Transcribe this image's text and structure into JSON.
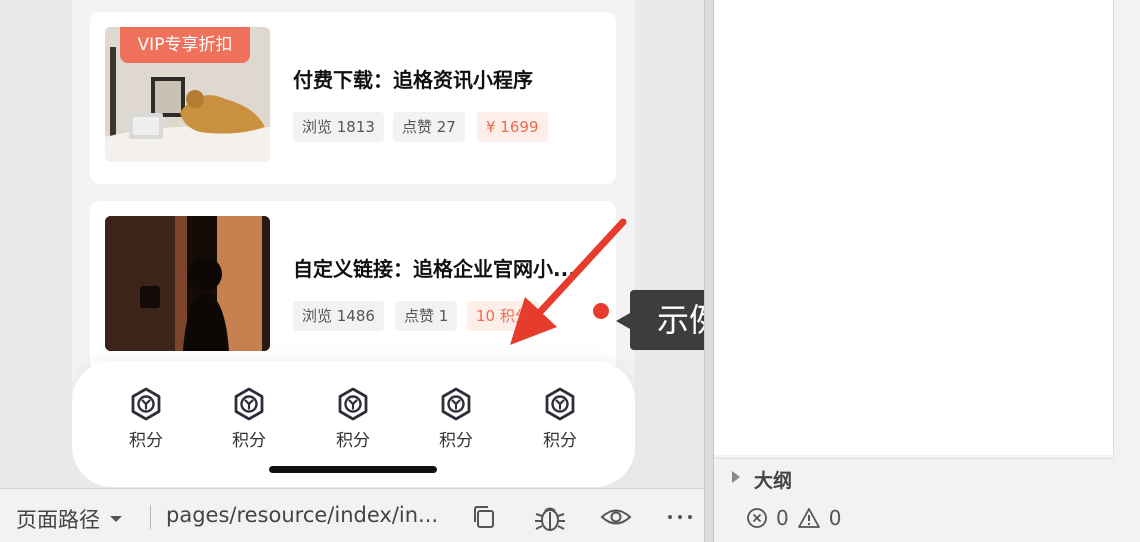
{
  "cards": [
    {
      "badge": "VIP专享折扣",
      "title": "付费下载：追格资讯小程序",
      "views": "浏览 1813",
      "likes": "点赞 27",
      "price": "¥ 1699"
    },
    {
      "title": "自定义链接：追格企业官网小...",
      "views": "浏览 1486",
      "likes": "点赞 1",
      "price": "10 积分"
    }
  ],
  "tabbar": {
    "items": [
      {
        "label": "积分",
        "icon": "cube-icon"
      },
      {
        "label": "积分",
        "icon": "cube-icon"
      },
      {
        "label": "积分",
        "icon": "cube-icon"
      },
      {
        "label": "积分",
        "icon": "cube-icon"
      },
      {
        "label": "积分",
        "icon": "cube-icon"
      }
    ]
  },
  "annotation": {
    "callout": "示例图",
    "arrow_color": "#e63c2d"
  },
  "bottombar": {
    "path_label": "页面路径",
    "path_value": "pages/resource/index/in...",
    "icons": [
      "copy-icon",
      "bug-icon",
      "eye-icon",
      "more-icon"
    ]
  },
  "outline": {
    "label": "大纲"
  },
  "problems": {
    "errors": "0",
    "warnings": "0"
  },
  "colors": {
    "accent": "#f0715b",
    "price_bg": "#fdeeea"
  }
}
